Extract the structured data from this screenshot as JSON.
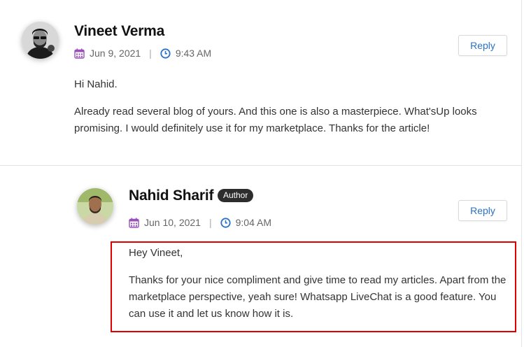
{
  "comments": [
    {
      "author": "Vineet Verma",
      "date": "Jun 9, 2021",
      "time": "9:43 AM",
      "reply_label": "Reply",
      "paragraphs": [
        "Hi Nahid.",
        "Already read several blog of yours. And this one is also a masterpiece. What'sUp looks promising. I would definitely use it for my marketplace. Thanks for the article!"
      ]
    },
    {
      "author": "Nahid Sharif",
      "badge": "Author",
      "date": "Jun 10, 2021",
      "time": "9:04 AM",
      "reply_label": "Reply",
      "paragraphs": [
        "Hey Vineet,",
        "Thanks for your nice compliment and give time to read my articles. Apart from the marketplace perspective, yeah sure! Whatsapp LiveChat is a good feature. You can use it and let us know how it is."
      ]
    }
  ],
  "meta_separator": "|",
  "icons": {
    "date": "calendar-icon",
    "time": "clock-icon"
  },
  "colors": {
    "calendar_icon": "#9b4fb8",
    "clock_icon": "#2a72c8",
    "reply_text": "#2a72c8",
    "highlight_border": "#e00000",
    "badge_bg": "#2d2d2d"
  }
}
